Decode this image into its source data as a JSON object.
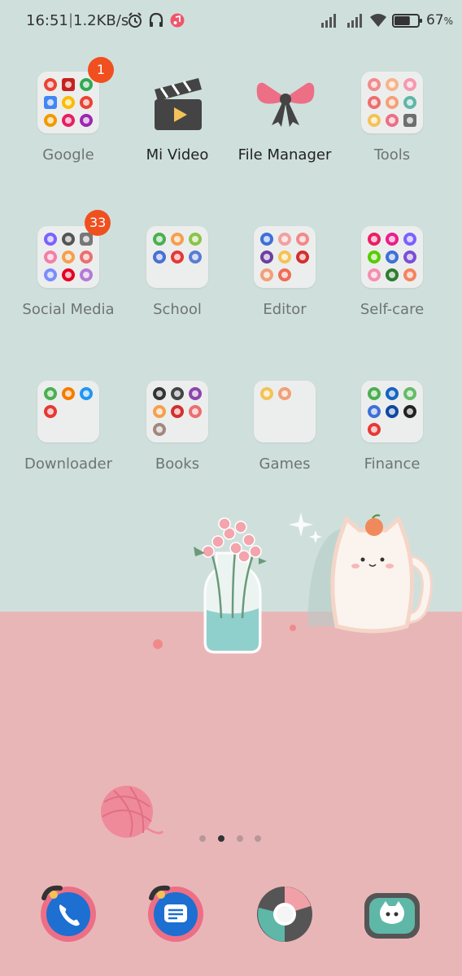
{
  "status_bar": {
    "time": "16:51",
    "separator": "|",
    "net_speed": "1.2KB/s",
    "battery_percent": "67",
    "battery_unit": "%",
    "battery_level": 0.67,
    "icons": [
      "alarm-icon",
      "headphones-icon",
      "music-icon",
      "signal-icon",
      "signal-icon",
      "wifi-icon",
      "battery-icon"
    ]
  },
  "apps": [
    {
      "label": "Google",
      "type": "folder",
      "badge": "1"
    },
    {
      "label": "Mi Video",
      "type": "app",
      "icon": "clapperboard-icon"
    },
    {
      "label": "File Manager",
      "type": "app",
      "icon": "bow-icon"
    },
    {
      "label": "Tools",
      "type": "folder"
    },
    {
      "label": "Social Media",
      "type": "folder",
      "badge": "33"
    },
    {
      "label": "School",
      "type": "folder"
    },
    {
      "label": "Editor",
      "type": "folder"
    },
    {
      "label": "Self-care",
      "type": "folder"
    },
    {
      "label": "Downloader",
      "type": "folder"
    },
    {
      "label": "Books",
      "type": "folder"
    },
    {
      "label": "Games",
      "type": "folder"
    },
    {
      "label": "Finance",
      "type": "folder"
    }
  ],
  "page_indicator": {
    "count": 4,
    "active_index": 1
  },
  "dock": [
    {
      "name": "phone-icon"
    },
    {
      "name": "messages-icon"
    },
    {
      "name": "browser-icon"
    },
    {
      "name": "camera-icon"
    }
  ],
  "colors": {
    "wall": "#cfe0dc",
    "floor": "#e9b6b8",
    "badge": "#f04f1f",
    "accent_pink": "#ec6f86",
    "accent_blue": "#1d6fd1"
  }
}
